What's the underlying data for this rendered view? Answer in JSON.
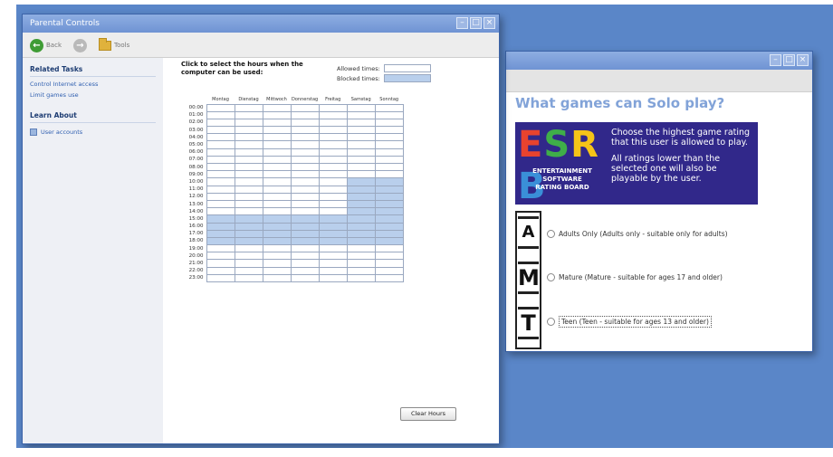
{
  "parental_window": {
    "title": "Parental Controls",
    "toolbar": {
      "back_label": "Back",
      "folder_label": "Tools"
    },
    "sidebar": {
      "related_head": "Related Tasks",
      "related_links": [
        "Control Internet access",
        "Limit games use"
      ],
      "learn_head": "Learn About",
      "learn_link": "User accounts"
    },
    "instructions": "Click to select the hours when the computer can be used:",
    "legend": {
      "allowed": "Allowed times:",
      "blocked": "Blocked times:"
    },
    "days": [
      "Montag",
      "Dienstag",
      "Mittwoch",
      "Donnerstag",
      "Freitag",
      "Samstag",
      "Sonntag"
    ],
    "hours": [
      "00:00",
      "01:00",
      "02:00",
      "03:00",
      "04:00",
      "05:00",
      "06:00",
      "07:00",
      "08:00",
      "09:00",
      "10:00",
      "11:00",
      "12:00",
      "13:00",
      "14:00",
      "15:00",
      "16:00",
      "17:00",
      "18:00",
      "19:00",
      "20:00",
      "21:00",
      "22:00",
      "23:00"
    ],
    "blocked": [
      [
        15,
        16,
        17,
        18
      ],
      [
        15,
        16,
        17,
        18
      ],
      [
        15,
        16,
        17,
        18
      ],
      [
        15,
        16,
        17,
        18
      ],
      [
        15,
        16,
        17,
        18
      ],
      [
        10,
        11,
        12,
        13,
        14,
        15,
        16,
        17,
        18
      ],
      [
        10,
        11,
        12,
        13,
        14,
        15,
        16,
        17,
        18
      ]
    ],
    "clear_button": "Clear Hours",
    "colors": {
      "blocked": "#b9cfec",
      "allowed": "#ffffff"
    }
  },
  "esrb_window": {
    "question": "What games can Solo play?",
    "logo_letters": [
      "E",
      "S",
      "R",
      "B"
    ],
    "logo_colors": [
      "#e8432e",
      "#3fae49",
      "#f5c418",
      "#3a8fd8"
    ],
    "logo_subtitle": [
      "ENTERTAINMENT",
      "SOFTWARE",
      "RATING BOARD"
    ],
    "description": [
      "Choose the highest game rating that this user is allowed to play.",
      "All ratings lower than the selected one will also be playable by the user."
    ],
    "ratings": [
      {
        "icon": "AO",
        "label": "Adults Only (Adults only - suitable only for adults)",
        "focused": false
      },
      {
        "icon": "M",
        "label": "Mature (Mature - suitable for ages 17 and older)",
        "focused": false
      },
      {
        "icon": "T",
        "label": "Teen (Teen - suitable for ages 13 and older)",
        "focused": true
      }
    ]
  }
}
